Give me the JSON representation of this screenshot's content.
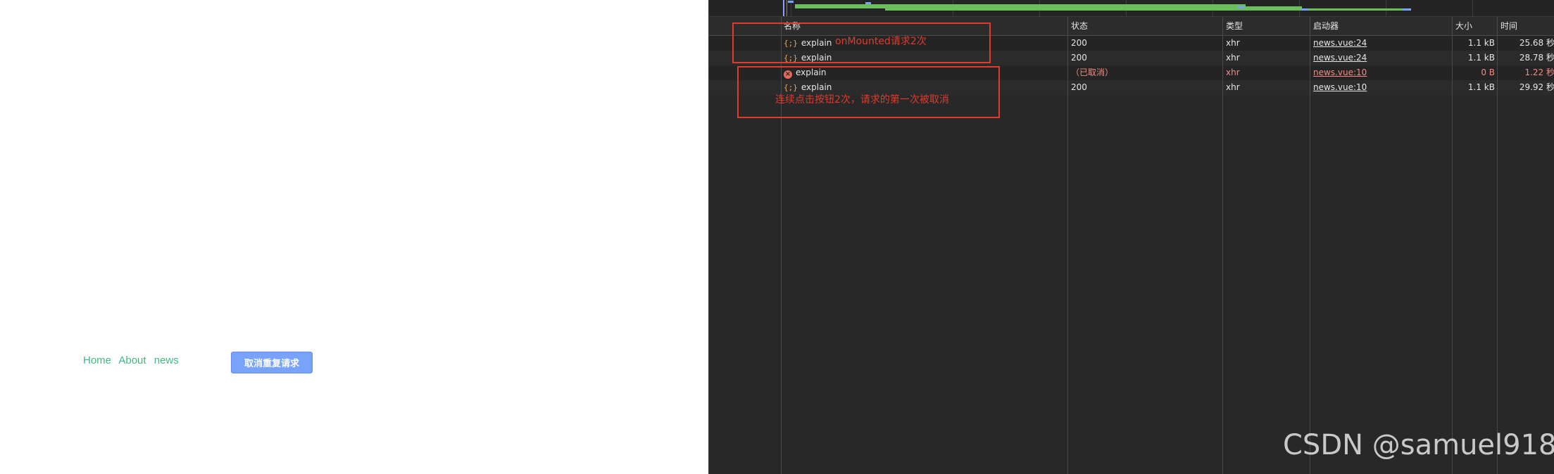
{
  "app": {
    "nav": [
      {
        "label": "Home"
      },
      {
        "label": "About"
      },
      {
        "label": "news"
      }
    ],
    "cancel_button": "取消重复请求"
  },
  "devtools": {
    "columns": {
      "name": "名称",
      "status": "状态",
      "type": "类型",
      "initiator": "启动器",
      "size": "大小",
      "time": "时间"
    },
    "rows": [
      {
        "icon": "xhr-icon",
        "name": "explain",
        "status": "200",
        "type": "xhr",
        "initiator": "news.vue:24",
        "size": "1.1 kB",
        "time": "25.68 秒"
      },
      {
        "icon": "xhr-icon",
        "name": "explain",
        "status": "200",
        "type": "xhr",
        "initiator": "news.vue:24",
        "size": "1.1 kB",
        "time": "28.78 秒"
      },
      {
        "icon": "error-icon",
        "name": "explain",
        "status": "（已取消）",
        "type": "xhr",
        "initiator": "news.vue:10",
        "size": "0 B",
        "time": "1.22 秒"
      },
      {
        "icon": "xhr-icon",
        "name": "explain",
        "status": "200",
        "type": "xhr",
        "initiator": "news.vue:10",
        "size": "1.1 kB",
        "time": "29.92 秒"
      }
    ]
  },
  "annotations": {
    "mounted_note": "onMounted请求2次",
    "cancel_note": "连续点击按钮2次，请求的第一次被取消"
  },
  "watermark": "CSDN @samuel918",
  "colors": {
    "nav_link": "#42b983",
    "button_bg": "#79a3f8",
    "annotation": "#e03b2c",
    "devtools_bg": "#282828"
  }
}
